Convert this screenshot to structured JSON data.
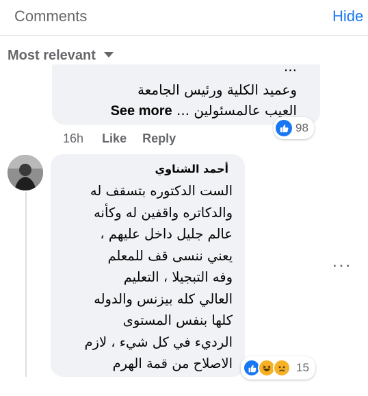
{
  "header": {
    "title": "Comments",
    "hide_label": "Hide"
  },
  "sort": {
    "label": "Most relevant"
  },
  "comment1": {
    "clipped_line": "...",
    "lines": [
      "وعميد الكلية ورئيس الجامعة",
      "العيب عالمسئولين ..."
    ],
    "see_more": "See more",
    "reaction_count": "98",
    "time": "16h",
    "like_label": "Like",
    "reply_label": "Reply"
  },
  "comment2": {
    "author": "أحمد الشناوي",
    "lines": [
      "الست الدكتوره بتسقف له",
      "والدكاتره واقفين له وكأنه",
      "عالم جليل داخل عليهم ،",
      "يعني ننسى قف للمعلم",
      "وفه التبجيلا ، التعليم",
      "العالي كله بيزنس والدوله",
      "كلها بنفس المستوى",
      "الرديء في كل شيء ، لازم",
      "الاصلاح من قمة الهرم"
    ],
    "reaction_count": "15",
    "reactions": [
      "like-icon",
      "haha-icon",
      "sad-icon"
    ]
  },
  "colors": {
    "accent": "#1877f2",
    "muted": "#65676b",
    "bubble": "#f0f2f5"
  }
}
